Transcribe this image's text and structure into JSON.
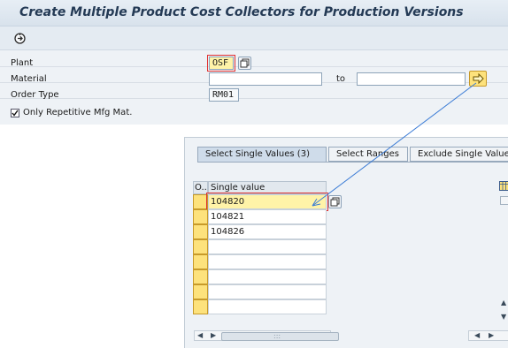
{
  "window": {
    "title": "Create Multiple Product Cost Collectors for Production Versions"
  },
  "toolbar": {
    "execute_icon": "execute-icon"
  },
  "form": {
    "plant": {
      "label": "Plant",
      "value": "OSF"
    },
    "material": {
      "label": "Material",
      "from_value": "",
      "to_label": "to",
      "to_value": ""
    },
    "order_type": {
      "label": "Order Type",
      "value": "RM01"
    },
    "only_repetitive": {
      "label": "Only Repetitive Mfg Mat.",
      "checked": true
    }
  },
  "popup": {
    "tabs": [
      {
        "label": "Select Single Values (3)",
        "active": true
      },
      {
        "label": "Select Ranges",
        "active": false
      },
      {
        "label": "Exclude Single Values",
        "active": false
      }
    ],
    "table": {
      "col_option": "O..",
      "col_value": "Single value",
      "rows": [
        "104820",
        "104821",
        "104826",
        "",
        "",
        "",
        "",
        ""
      ]
    },
    "scrollbar_center_glyph": ":::"
  },
  "colors": {
    "accent": "#3a7bd5",
    "highlight": "#e03030",
    "required_field": "#fff3a8"
  }
}
